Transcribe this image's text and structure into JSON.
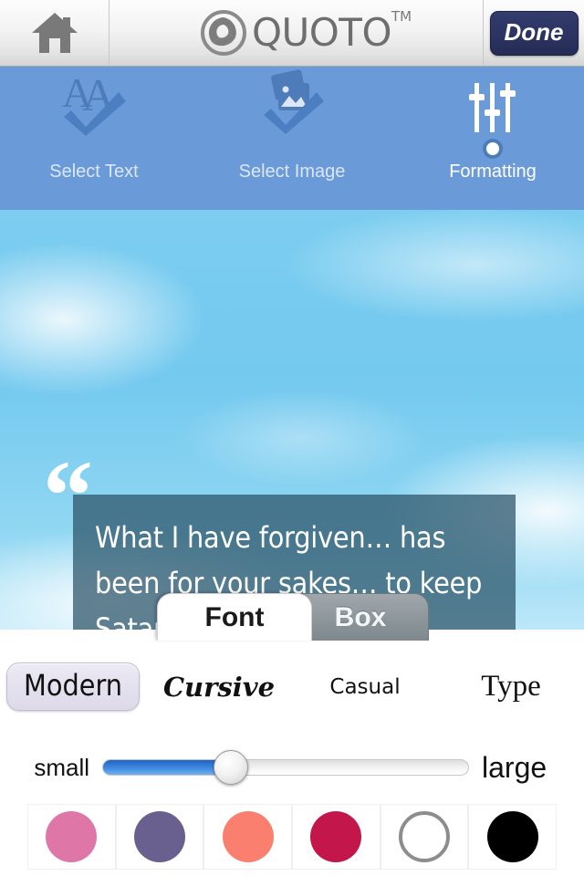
{
  "header": {
    "home_icon": "home-icon",
    "logo_text": "QUOTO",
    "trademark": "TM",
    "done_label": "Done"
  },
  "steps": {
    "items": [
      {
        "label": "Select Text",
        "icon": "text-check-icon",
        "state": "complete"
      },
      {
        "label": "Select Image",
        "icon": "image-check-icon",
        "state": "complete"
      },
      {
        "label": "Formatting",
        "icon": "sliders-icon",
        "state": "active"
      }
    ],
    "bar_color": "#6a9bd8"
  },
  "canvas": {
    "quote_text": "What I have forgiven… has been for your sakes… to keep Satan from getting the advantage over us; for we are not ignorant of his wiles and intentions.",
    "open_quote_mark": "“",
    "close_quote_mark": "”",
    "box_color": "#2a5266"
  },
  "tabs": [
    {
      "label": "Font",
      "active": true
    },
    {
      "label": "Box",
      "active": false
    }
  ],
  "font_options": [
    {
      "label": "Modern",
      "selected": true
    },
    {
      "label": "Cursive",
      "selected": false
    },
    {
      "label": "Casual",
      "selected": false
    },
    {
      "label": "Type",
      "selected": false
    }
  ],
  "size_slider": {
    "min_label": "small",
    "max_label": "large",
    "value_percent": 35,
    "fill_color": "#3f8ae0"
  },
  "color_swatches": [
    {
      "name": "pink",
      "hex": "#de76a8",
      "outlined": false
    },
    {
      "name": "purple",
      "hex": "#6a6090",
      "outlined": false
    },
    {
      "name": "coral",
      "hex": "#fa7f6e",
      "outlined": false
    },
    {
      "name": "crimson",
      "hex": "#c3174c",
      "outlined": false
    },
    {
      "name": "white",
      "hex": "#ffffff",
      "outlined": true
    },
    {
      "name": "black",
      "hex": "#000000",
      "outlined": false
    }
  ]
}
